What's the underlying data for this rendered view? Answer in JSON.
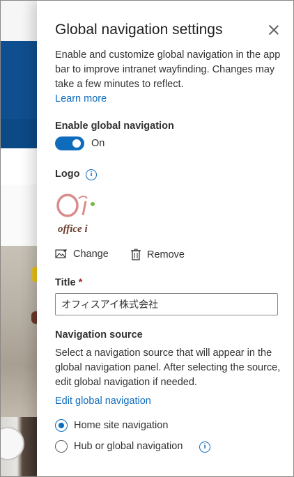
{
  "panel": {
    "title": "Global navigation settings",
    "description": "Enable and customize global navigation in the app bar to improve intranet wayfinding. Changes may take a few minutes to reflect.",
    "learn_more": "Learn more"
  },
  "enable_section": {
    "label": "Enable global navigation",
    "toggle_state": "On",
    "toggle_on": true
  },
  "logo_section": {
    "label": "Logo",
    "info_icon": "info-icon",
    "logo_text": "office i",
    "change_label": "Change",
    "remove_label": "Remove"
  },
  "title_section": {
    "label": "Title",
    "required_mark": "*",
    "value": "オフィスアイ株式会社"
  },
  "navigation_source": {
    "label": "Navigation source",
    "description": "Select a navigation source that will appear in the global navigation panel. After selecting the source, edit global navigation if needed.",
    "edit_link": "Edit global navigation",
    "options": [
      {
        "label": "Home site navigation",
        "selected": true
      },
      {
        "label": "Hub or global navigation",
        "selected": false
      }
    ]
  },
  "colors": {
    "accent": "#0f6cbd",
    "text": "#323130",
    "required": "#a4262c"
  }
}
